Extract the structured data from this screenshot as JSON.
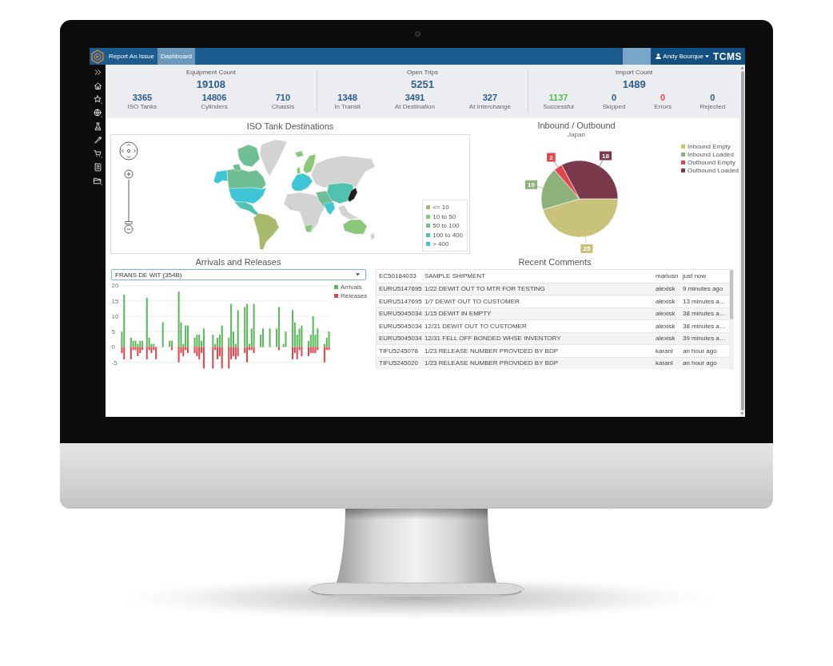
{
  "nav": {
    "links": [
      {
        "label": "Report An Issue",
        "selected": false
      },
      {
        "label": "Dashboard",
        "selected": true
      }
    ],
    "user": "Andy Bourque",
    "logo_text": "TCMS"
  },
  "stats": [
    {
      "title": "Equipment Count",
      "total": "19108",
      "items": [
        {
          "value": "3365",
          "label": "ISO Tanks"
        },
        {
          "value": "14806",
          "label": "Cylinders"
        },
        {
          "value": "710",
          "label": "Chassis"
        }
      ]
    },
    {
      "title": "Open Trips",
      "total": "5251",
      "items": [
        {
          "value": "1348",
          "label": "In Transit"
        },
        {
          "value": "3491",
          "label": "At Destination"
        },
        {
          "value": "327",
          "label": "At Interchange"
        }
      ]
    },
    {
      "title": "Import Count",
      "total": "1489",
      "items": [
        {
          "value": "1137",
          "label": "Successful",
          "color": "#5cb85c"
        },
        {
          "value": "0",
          "label": "Skipped",
          "color": "#2b5d8c"
        },
        {
          "value": "0",
          "label": "Errors",
          "color": "#e0474c"
        },
        {
          "value": "0",
          "label": "Rejected",
          "color": "#2b5d8c"
        }
      ]
    }
  ],
  "iso_map": {
    "title": "ISO Tank Destinations",
    "zoom": {
      "level": 0
    },
    "legend": [
      {
        "label": "<= 10",
        "color": "#a9b96b"
      },
      {
        "label": "10 to 50",
        "color": "#8bc77a"
      },
      {
        "label": "50 to 100",
        "color": "#6fbe94"
      },
      {
        "label": "100 to 400",
        "color": "#4fc3b0"
      },
      {
        "label": "> 400",
        "color": "#3ec5d6"
      }
    ]
  },
  "inbound_outbound": {
    "subtitle": "Japan",
    "chart_data": {
      "type": "pie",
      "title": "Inbound / Outbound",
      "categories": [
        "Inbound Empty",
        "Inbound Loaded",
        "Outbound Empty",
        "Outbound Loaded"
      ],
      "values": [
        25,
        10,
        2,
        18
      ],
      "colors": [
        "#c8c27a",
        "#8db27b",
        "#e2464b",
        "#7b3a4b"
      ],
      "data_labels": true,
      "legend": "right"
    }
  },
  "arrivals_releases": {
    "title": "Arrivals and Releases",
    "dropdown": {
      "value": "FRANS DE WIT (354B)"
    },
    "chart_data": {
      "type": "bar",
      "series": [
        {
          "name": "Arrivals",
          "color": "#5cb85c",
          "values": [
            5,
            17,
            null,
            null,
            3,
            2,
            2,
            1,
            2,
            2,
            null,
            16,
            3,
            1,
            1,
            0,
            null,
            null,
            8,
            null,
            null,
            2,
            2,
            null,
            null,
            18,
            8,
            1,
            7,
            7,
            null,
            null,
            3,
            4,
            4,
            2,
            6,
            null,
            null,
            null,
            4,
            1,
            3,
            4,
            7,
            null,
            null,
            3,
            14,
            5,
            1,
            12,
            null,
            null,
            13,
            14,
            1,
            6,
            14,
            null,
            null,
            4,
            6,
            null,
            null,
            6,
            null,
            null,
            6,
            13,
            null,
            1,
            5,
            null,
            null,
            12,
            8,
            4,
            6,
            7,
            null,
            null,
            2,
            4,
            10,
            4,
            6,
            null,
            null,
            1,
            3,
            5
          ]
        },
        {
          "name": "Releases",
          "color": "#e0474c",
          "values": [
            -2,
            -4,
            null,
            null,
            -4,
            -1,
            -1,
            -3,
            -2,
            -1,
            null,
            -4,
            -1,
            -2,
            -1,
            -4,
            null,
            null,
            0,
            null,
            null,
            0,
            -1,
            null,
            null,
            -5,
            -2,
            -3,
            -1,
            -2,
            null,
            null,
            -2,
            -3,
            -4,
            -2,
            -7,
            null,
            null,
            null,
            -7,
            -1,
            -4,
            -3,
            -7,
            null,
            null,
            -7,
            -4,
            -3,
            -4,
            -3,
            null,
            null,
            -2,
            -5,
            -1,
            -1,
            -2,
            null,
            null,
            0,
            0,
            null,
            null,
            0,
            null,
            null,
            0,
            -1,
            null,
            0,
            0,
            null,
            null,
            -4,
            -2,
            -4,
            -1,
            -3,
            null,
            null,
            -3,
            -2,
            -2,
            -2,
            -1,
            null,
            null,
            -5,
            -1,
            -1
          ]
        }
      ],
      "ylim": [
        -7.5,
        20
      ],
      "yticks": [
        -5,
        0,
        5,
        10,
        15,
        20
      ],
      "stacked": true,
      "grid": true,
      "legend": "right"
    }
  },
  "recent_comments": {
    "title": "Recent Comments",
    "rows": [
      {
        "container": "EC50184033",
        "comment": "SAMPLE SHIPMENT",
        "user": "mariusn",
        "time": "just now"
      },
      {
        "container": "EURU5147695",
        "comment": "1/22 DEWIT OUT TO MTR FOR TESTING",
        "user": "alexisk",
        "time": "9 minutes ago"
      },
      {
        "container": "EURU5147695",
        "comment": "1/7 DEWIT OUT TO CUSTOMER",
        "user": "alexisk",
        "time": "13 minutes a…"
      },
      {
        "container": "EURU5045034",
        "comment": "1/15 DEWIT IN EMPTY",
        "user": "alexisk",
        "time": "38 minutes a…"
      },
      {
        "container": "EURU5045034",
        "comment": "12/31 DEWIT OUT TO CUSTOMER",
        "user": "alexisk",
        "time": "38 minutes a…"
      },
      {
        "container": "EURU5045034",
        "comment": "12/31 FELL OFF BONDED WHSE INVENTORY",
        "user": "alexisk",
        "time": "39 minutes a…"
      },
      {
        "container": "TIFU5245078",
        "comment": "1/23 RELEASE NUMBER PROVIDED BY BDP",
        "user": "karanl",
        "time": "an hour ago"
      },
      {
        "container": "TIFU5245020",
        "comment": "1/23 RELEASE NUMBER PROVIDED BY BDP",
        "user": "karanl",
        "time": "an hour ago"
      }
    ]
  }
}
